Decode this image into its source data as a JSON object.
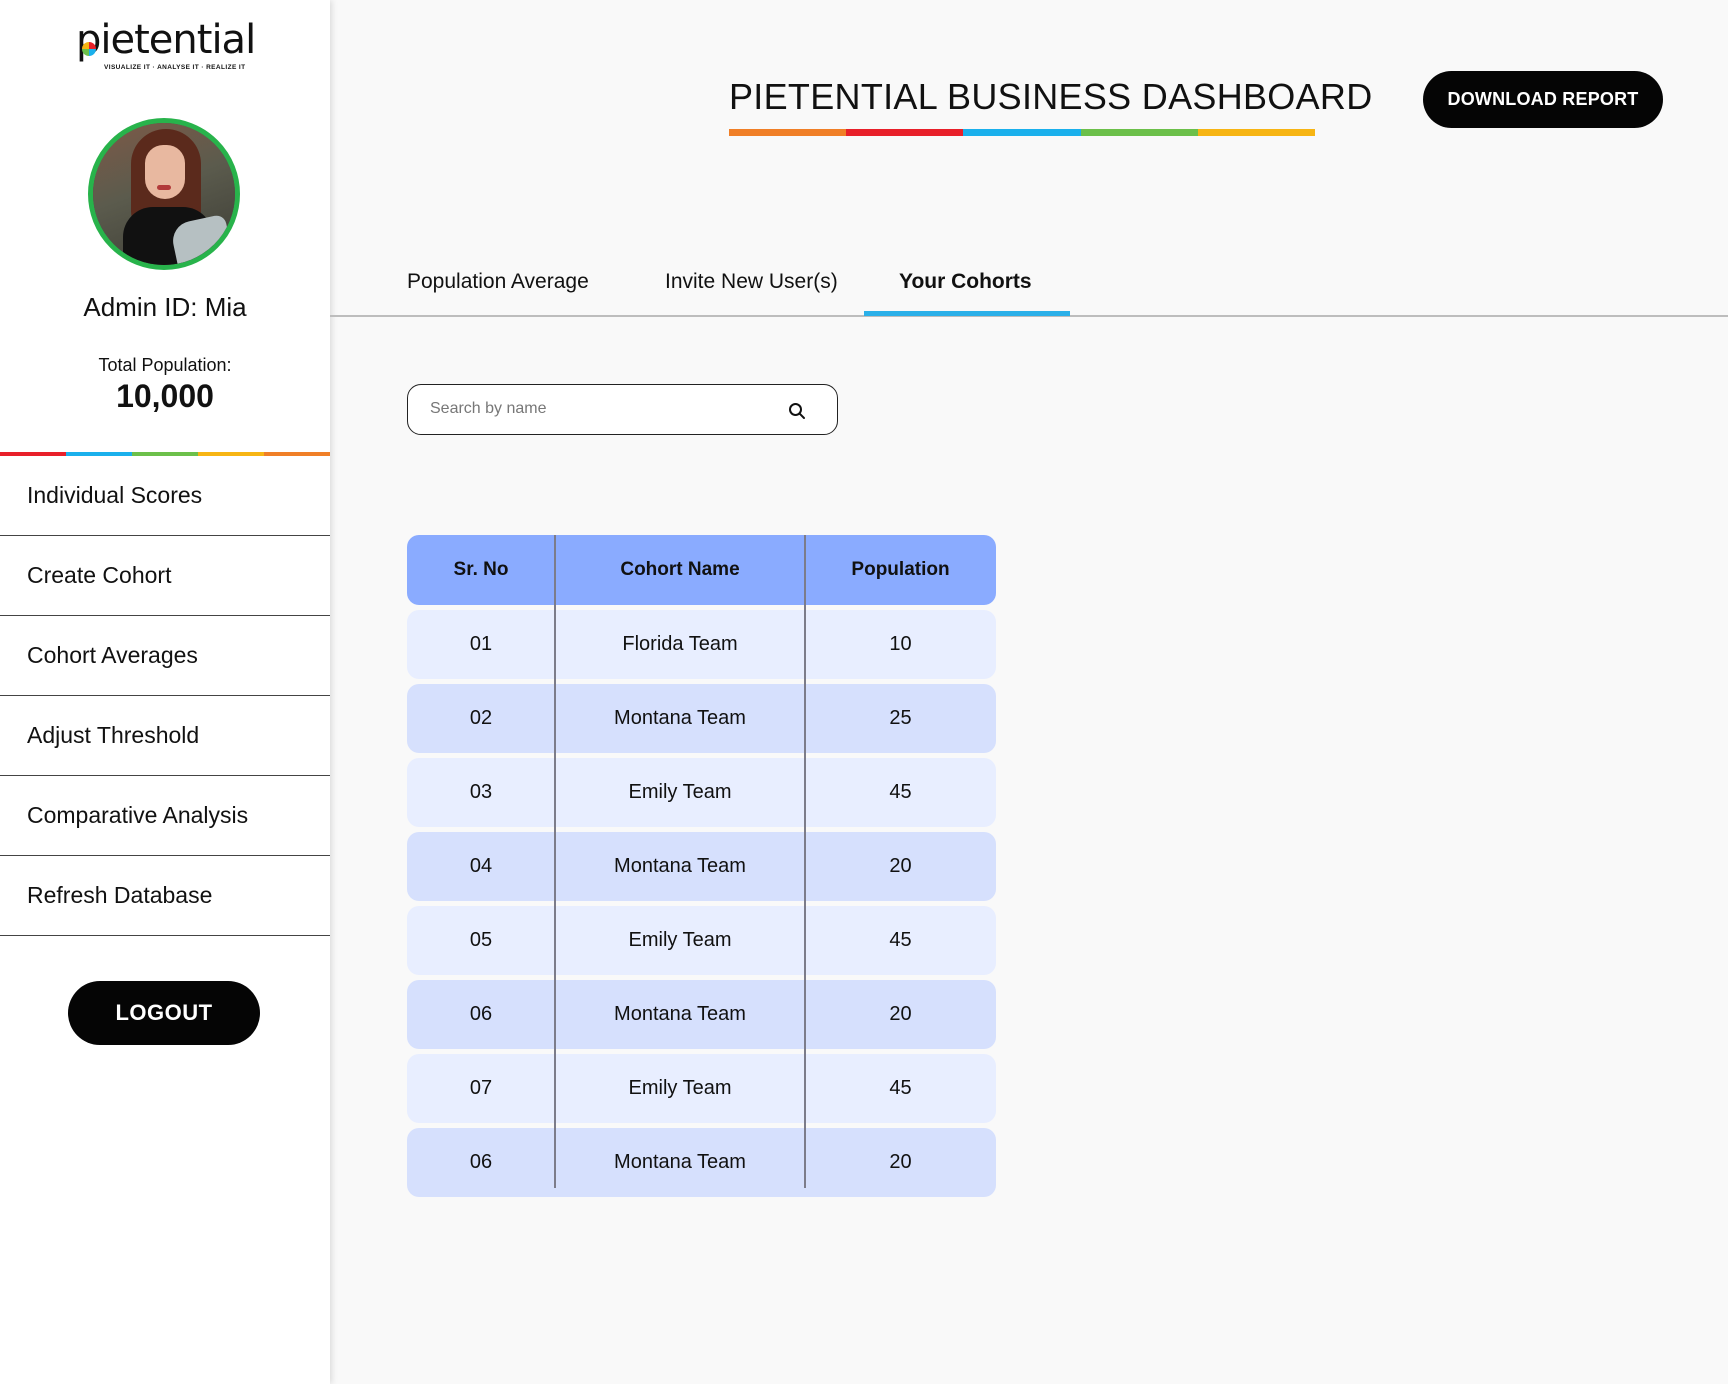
{
  "brand": {
    "logo_text": "pietential",
    "tagline": "VISUALIZE IT · ANALYSE IT · REALIZE IT",
    "colors": [
      "#f07f27",
      "#e8202a",
      "#1ab0ec",
      "#6cc04a",
      "#f7b514"
    ]
  },
  "profile": {
    "admin_id": "Admin ID: Mia",
    "total_label": "Total Population:",
    "total_value": "10,000"
  },
  "sidebar": {
    "items": [
      {
        "label": "Individual Scores"
      },
      {
        "label": "Create Cohort"
      },
      {
        "label": "Cohort Averages"
      },
      {
        "label": "Adjust Threshold"
      },
      {
        "label": "Comparative Analysis"
      },
      {
        "label": "Refresh Database"
      }
    ],
    "logout_label": "LOGOUT"
  },
  "header": {
    "title": "PIETENTIAL BUSINESS DASHBOARD",
    "download_label": "DOWNLOAD REPORT"
  },
  "tabs": [
    {
      "label": "Population Average",
      "active": false
    },
    {
      "label": "Invite New User(s)",
      "active": false
    },
    {
      "label": "Your Cohorts",
      "active": true
    }
  ],
  "search": {
    "placeholder": "Search by name",
    "value": ""
  },
  "table": {
    "columns": [
      "Sr. No",
      "Cohort Name",
      "Population"
    ],
    "rows": [
      [
        "01",
        "Florida Team",
        "10"
      ],
      [
        "02",
        "Montana Team",
        "25"
      ],
      [
        "03",
        "Emily Team",
        "45"
      ],
      [
        "04",
        "Montana Team",
        "20"
      ],
      [
        "05",
        "Emily Team",
        "45"
      ],
      [
        "06",
        "Montana Team",
        "20"
      ],
      [
        "07",
        "Emily Team",
        "45"
      ],
      [
        "06",
        "Montana Team",
        "20"
      ]
    ]
  }
}
